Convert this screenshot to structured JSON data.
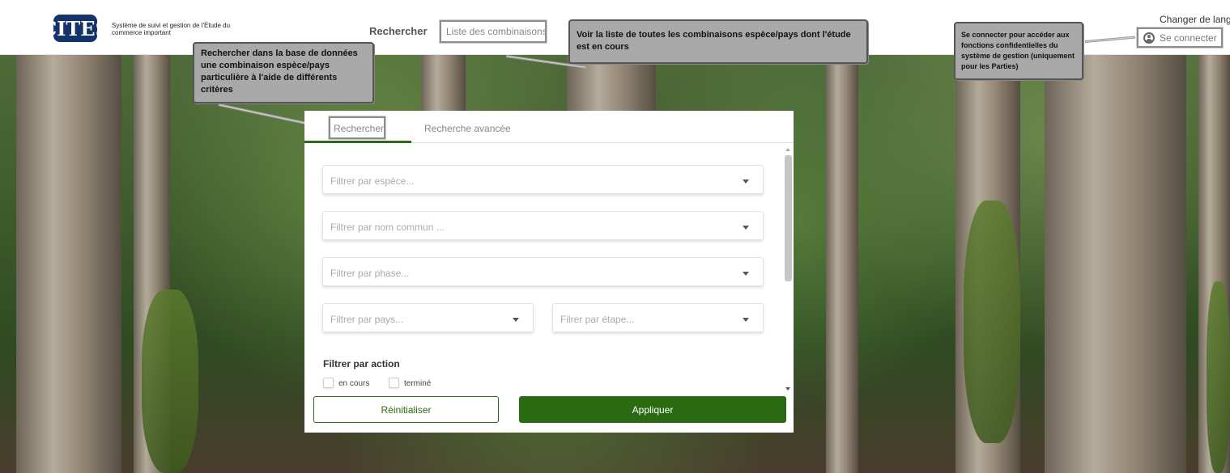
{
  "header": {
    "logo_text": "CITES",
    "logo_caption": "Système de suivi et gestion de l'Étude du commerce important",
    "nav_search": "Rechercher",
    "nav_list": "Liste des combinaisons",
    "change_language": "Changer de langue",
    "login": "Se connecter",
    "login_icon": "user-circle-icon"
  },
  "callouts": {
    "search_help": "Rechercher dans la base de données une combinaison espèce/pays particulière à l'aide de différents critères",
    "list_help": "Voir la liste de toutes les combinaisons espèce/pays dont l'étude est en cours",
    "login_help": "Se connecter pour accéder aux fonctions confidentielles du système de gestion (uniquement pour les Parties)"
  },
  "tabs": {
    "search": "Rechercher",
    "advanced": "Recherche avancée"
  },
  "filters": {
    "species": "Filtrer par espèce...",
    "common_name": "Filtrer par nom commun ...",
    "phase": "Filtrer par phase...",
    "country": "Filtrer par pays...",
    "stage": "Filrer par étape..."
  },
  "action_filter": {
    "label": "Filtrer par action",
    "options": [
      "en cours",
      "terminé"
    ]
  },
  "buttons": {
    "reset": "Réinitialiser",
    "apply": "Appliquer"
  },
  "colors": {
    "accent": "#2a6b12",
    "callout_bg": "#a9a9a9"
  }
}
